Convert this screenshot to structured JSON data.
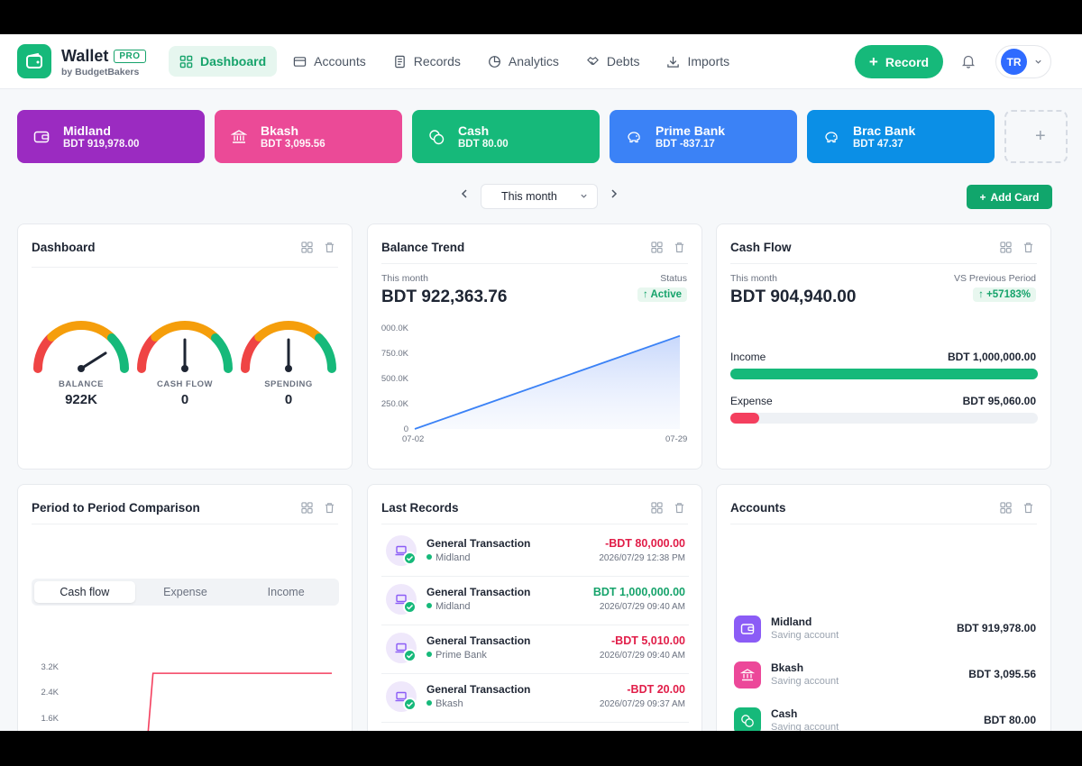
{
  "app": {
    "name": "Wallet",
    "badge": "PRO",
    "subtitle": "by BudgetBakers"
  },
  "nav": [
    {
      "label": "Dashboard",
      "icon": "grid-icon",
      "active": true
    },
    {
      "label": "Accounts",
      "icon": "card-icon"
    },
    {
      "label": "Records",
      "icon": "document-icon"
    },
    {
      "label": "Analytics",
      "icon": "pie-chart-icon"
    },
    {
      "label": "Debts",
      "icon": "handshake-icon"
    },
    {
      "label": "Imports",
      "icon": "download-icon"
    }
  ],
  "header": {
    "record_label": "Record",
    "user_initials": "TR"
  },
  "accounts_strip": [
    {
      "name": "Midland",
      "balance": "BDT 919,978.00",
      "color": "#9b2bc1",
      "icon": "wallet-icon"
    },
    {
      "name": "Bkash",
      "balance": "BDT 3,095.56",
      "color": "#eb4a97",
      "icon": "bank-icon"
    },
    {
      "name": "Cash",
      "balance": "BDT 80.00",
      "color": "#16b97a",
      "icon": "coins-icon"
    },
    {
      "name": "Prime Bank",
      "balance": "BDT -837.17",
      "color": "#3b82f6",
      "icon": "piggy-bank-icon"
    },
    {
      "name": "Brac Bank",
      "balance": "BDT 47.37",
      "color": "#0b8fe6",
      "icon": "piggy-bank-icon"
    }
  ],
  "add_account_symbol": "+",
  "period": {
    "label": "This month",
    "add_card_label": "Add Card"
  },
  "widgets": {
    "dashboard": {
      "title": "Dashboard",
      "gauges": [
        {
          "label": "BALANCE",
          "value": "922K",
          "needle_fraction": 0.82
        },
        {
          "label": "CASH FLOW",
          "value": "0",
          "needle_fraction": 0.5
        },
        {
          "label": "SPENDING",
          "value": "0",
          "needle_fraction": 0.5
        }
      ]
    },
    "balance_trend": {
      "title": "Balance Trend",
      "period_label": "This month",
      "status_label": "Status",
      "amount": "BDT 922,363.76",
      "status_value": "↑ Active"
    },
    "cash_flow": {
      "title": "Cash Flow",
      "period_label": "This month",
      "compare_label": "VS Previous Period",
      "amount": "BDT 904,940.00",
      "change": "↑ +57183%",
      "income_label": "Income",
      "income_value": "BDT 1,000,000.00",
      "income_fraction": 1.0,
      "expense_label": "Expense",
      "expense_value": "BDT 95,060.00",
      "expense_fraction": 0.095,
      "income_color": "#16b97a",
      "expense_color": "#f43f5e"
    },
    "comparison": {
      "title": "Period to Period Comparison",
      "tabs": [
        "Cash flow",
        "Expense",
        "Income"
      ],
      "active_tab": 0
    },
    "last_records": {
      "title": "Last Records",
      "items": [
        {
          "title": "General Transaction",
          "account": "Midland",
          "amount": "-BDT 80,000.00",
          "date": "2026/07/29 12:38 PM",
          "type": "negative"
        },
        {
          "title": "General Transaction",
          "account": "Midland",
          "amount": "BDT 1,000,000.00",
          "date": "2026/07/29 09:40 AM",
          "type": "positive"
        },
        {
          "title": "General Transaction",
          "account": "Prime Bank",
          "amount": "-BDT 5,010.00",
          "date": "2026/07/29 09:40 AM",
          "type": "negative"
        },
        {
          "title": "General Transaction",
          "account": "Bkash",
          "amount": "-BDT 20.00",
          "date": "2026/07/29 09:37 AM",
          "type": "negative"
        }
      ]
    },
    "accounts": {
      "title": "Accounts",
      "items": [
        {
          "name": "Midland",
          "type": "Saving account",
          "balance": "BDT 919,978.00",
          "color": "#8b5cf6",
          "icon": "wallet-icon"
        },
        {
          "name": "Bkash",
          "type": "Saving account",
          "balance": "BDT 3,095.56",
          "color": "#ec4899",
          "icon": "bank-icon"
        },
        {
          "name": "Cash",
          "type": "Saving account",
          "balance": "BDT 80.00",
          "color": "#16b97a",
          "icon": "coins-icon"
        }
      ]
    }
  },
  "chart_data": [
    {
      "type": "area",
      "x": [
        "07-02",
        "07-29"
      ],
      "values": [
        0,
        922363.76
      ],
      "ytick_labels": [
        "0",
        "250.0K",
        "500.0K",
        "750.0K",
        "000.0K"
      ],
      "ylim": [
        0,
        1000000
      ],
      "grid": false
    },
    {
      "type": "line",
      "ytick_labels": [
        "1.6K",
        "2.4K",
        "3.2K"
      ],
      "y_ticks": [
        1600,
        2400,
        3200
      ],
      "points": [
        {
          "x": 0.3,
          "y": 0
        },
        {
          "x": 0.33,
          "y": 3000
        },
        {
          "x": 1.0,
          "y": 3000
        }
      ]
    }
  ]
}
